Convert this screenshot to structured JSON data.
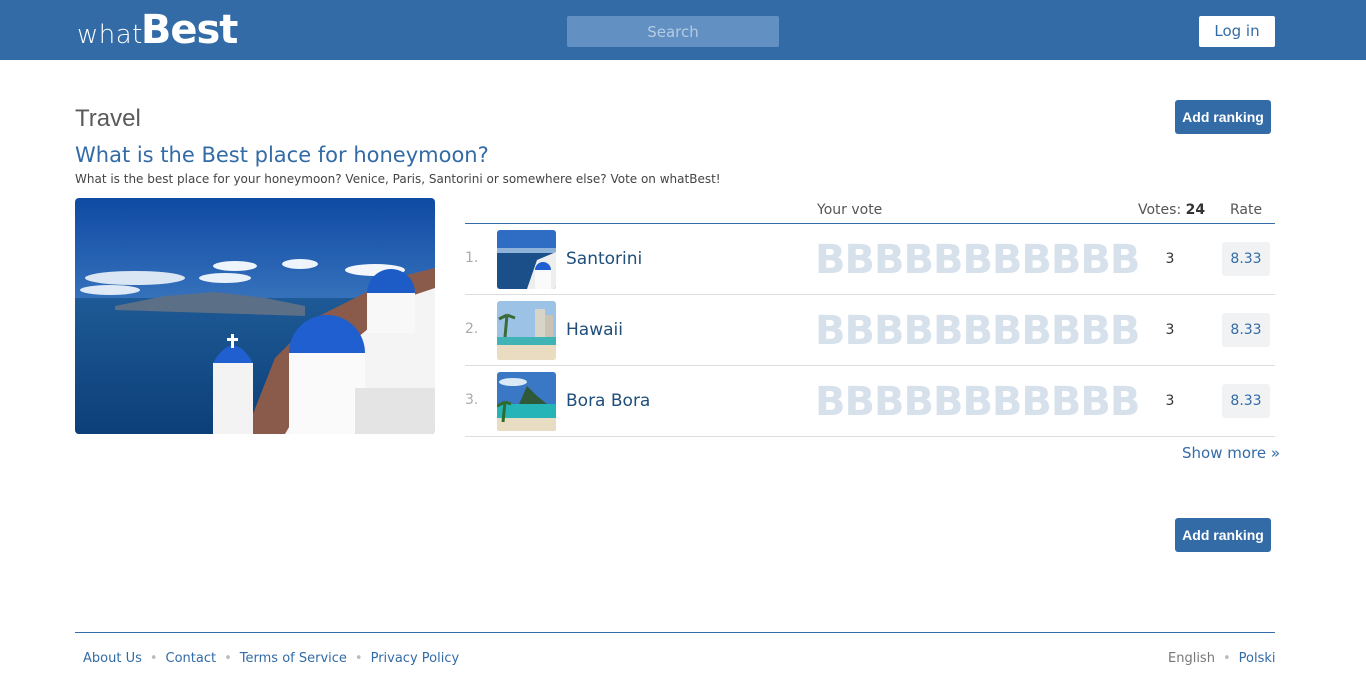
{
  "header": {
    "logo_what": "what",
    "logo_best": "Best",
    "search_placeholder": "Search",
    "login_label": "Log in"
  },
  "main": {
    "category": "Travel",
    "add_ranking_label": "Add ranking",
    "question_title": "What is the Best place for honeymoon?",
    "question_desc": "What is the best place for your honeymoon? Venice, Paris, Santorini or somewhere else? Vote on whatBest!",
    "table": {
      "your_vote_header": "Your vote",
      "votes_header": "Votes:",
      "votes_total": "24",
      "rate_header": "Rate",
      "rows": [
        {
          "rank": "1.",
          "name": "Santorini",
          "stars": "BBBBBBBBBBB",
          "votes": "3",
          "rate": "8.33"
        },
        {
          "rank": "2.",
          "name": "Hawaii",
          "stars": "BBBBBBBBBBB",
          "votes": "3",
          "rate": "8.33"
        },
        {
          "rank": "3.",
          "name": "Bora Bora",
          "stars": "BBBBBBBBBBB",
          "votes": "3",
          "rate": "8.33"
        }
      ]
    },
    "show_more": "Show more »"
  },
  "footer": {
    "links": [
      "About Us",
      "Contact",
      "Terms of Service",
      "Privacy Policy"
    ],
    "languages": [
      "English",
      "Polski"
    ]
  },
  "colors": {
    "brand": "#336ba6",
    "star_inactive": "#d6e1ec"
  }
}
